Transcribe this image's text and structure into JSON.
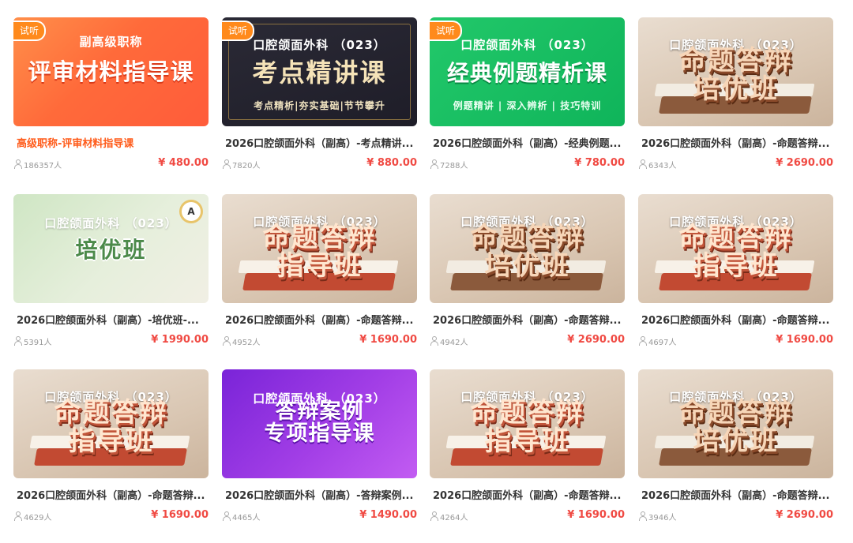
{
  "courses": [
    {
      "badge": "试听",
      "corner_badge": "",
      "thumb_headline": "副高级职称",
      "thumb_big": "评审材料指导课",
      "thumb_tag": "",
      "title": "高级职称-评审材料指导课",
      "students": "186357人",
      "price": "¥ 480.00"
    },
    {
      "badge": "试听",
      "corner_badge": "",
      "thumb_headline": "口腔颌面外科 （023）",
      "thumb_big": "考点精讲课",
      "thumb_tag": "考点精析|夯实基础|节节攀升",
      "title": "2026口腔颌面外科（副高）-考点精讲...",
      "students": "7820人",
      "price": "¥ 880.00"
    },
    {
      "badge": "试听",
      "corner_badge": "",
      "thumb_headline": "口腔颌面外科 （023）",
      "thumb_big": "经典例题精析课",
      "thumb_tag": "例题精讲 | 深入辨析 | 技巧特训",
      "title": "2026口腔颌面外科（副高）-经典例题...",
      "students": "7288人",
      "price": "¥ 780.00"
    },
    {
      "badge": "",
      "corner_badge": "",
      "thumb_headline": "口腔颌面外科 （023）",
      "thumb_big": "命题答辩\n培优班",
      "thumb_tag": "",
      "title": "2026口腔颌面外科（副高）-命题答辩...",
      "students": "6343人",
      "price": "¥ 2690.00"
    },
    {
      "badge": "",
      "corner_badge": "A",
      "thumb_headline": "口腔颌面外科 （023）",
      "thumb_big": "培优班",
      "thumb_tag": "",
      "title": "2026口腔颌面外科（副高）-培优班-...",
      "students": "5391人",
      "price": "¥ 1990.00"
    },
    {
      "badge": "",
      "corner_badge": "",
      "thumb_headline": "口腔颌面外科 （023）",
      "thumb_big": "命题答辩\n指导班",
      "thumb_tag": "",
      "title": "2026口腔颌面外科（副高）-命题答辩...",
      "students": "4952人",
      "price": "¥ 1690.00"
    },
    {
      "badge": "",
      "corner_badge": "",
      "thumb_headline": "口腔颌面外科 （023）",
      "thumb_big": "命题答辩\n培优班",
      "thumb_tag": "",
      "title": "2026口腔颌面外科（副高）-命题答辩...",
      "students": "4942人",
      "price": "¥ 2690.00"
    },
    {
      "badge": "",
      "corner_badge": "",
      "thumb_headline": "口腔颌面外科 （023）",
      "thumb_big": "命题答辩\n指导班",
      "thumb_tag": "",
      "title": "2026口腔颌面外科（副高）-命题答辩...",
      "students": "4697人",
      "price": "¥ 1690.00"
    },
    {
      "badge": "",
      "corner_badge": "",
      "thumb_headline": "口腔颌面外科 （023）",
      "thumb_big": "命题答辩\n指导班",
      "thumb_tag": "",
      "title": "2026口腔颌面外科（副高）-命题答辩...",
      "students": "4629人",
      "price": "¥ 1690.00"
    },
    {
      "badge": "",
      "corner_badge": "",
      "thumb_headline": "口腔颌面外科 （023）",
      "thumb_big": "答辩案例\n专项指导课",
      "thumb_tag": "",
      "title": "2026口腔颌面外科（副高）-答辩案例...",
      "students": "4465人",
      "price": "¥ 1490.00"
    },
    {
      "badge": "",
      "corner_badge": "",
      "thumb_headline": "口腔颌面外科 （023）",
      "thumb_big": "命题答辩\n指导班",
      "thumb_tag": "",
      "title": "2026口腔颌面外科（副高）-命题答辩...",
      "students": "4264人",
      "price": "¥ 1690.00"
    },
    {
      "badge": "",
      "corner_badge": "",
      "thumb_headline": "口腔颌面外科 （023）",
      "thumb_big": "命题答辩\n培优班",
      "thumb_tag": "",
      "title": "2026口腔颌面外科（副高）-命题答辩...",
      "students": "3946人",
      "price": "¥ 2690.00"
    }
  ],
  "colors": {
    "price": "#f04a43",
    "trial_badge": "#ff8a1c",
    "highlight_title": "#ff5b1a"
  },
  "icons": {
    "students": "person-icon"
  }
}
